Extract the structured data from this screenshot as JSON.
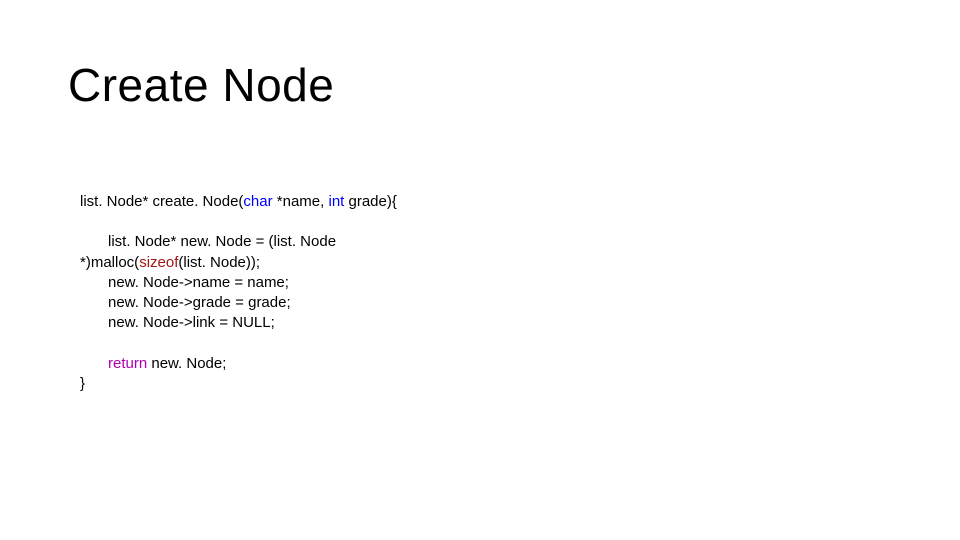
{
  "title": "Create Node",
  "code": {
    "sig": {
      "p1": "list. Node* create. Node(",
      "kw1": "char",
      "p2": " *name, ",
      "kw2": "int",
      "p3": " grade){"
    },
    "body1a": "list. Node* new. Node = (list. Node",
    "body1b_p1": "*)malloc(",
    "body1b_kw": "sizeof",
    "body1b_p2": "(list. Node));",
    "body2": "new. Node->name = name;",
    "body3": "new. Node->grade = grade;",
    "body4": "new. Node->link = NULL;",
    "ret_kw": "return",
    "ret_rest": " new. Node;",
    "close": "}"
  }
}
